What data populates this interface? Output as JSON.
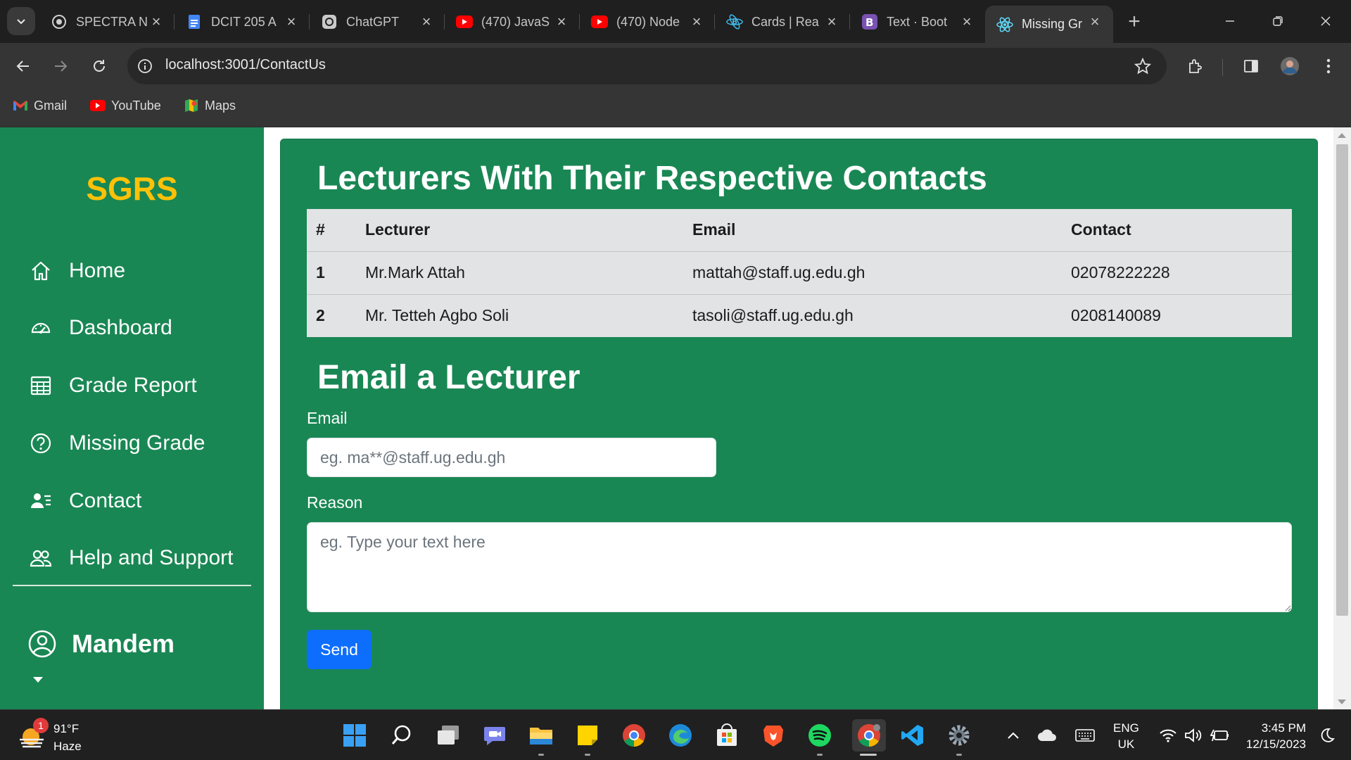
{
  "browser": {
    "tabs": [
      {
        "title": "SPECTRA N",
        "icon": "spectra-icon"
      },
      {
        "title": "DCIT 205 A",
        "icon": "google-docs-icon"
      },
      {
        "title": "ChatGPT",
        "icon": "chatgpt-icon"
      },
      {
        "title": "(470) JavaS",
        "icon": "youtube-icon"
      },
      {
        "title": "(470) Node",
        "icon": "youtube-icon"
      },
      {
        "title": "Cards | Rea",
        "icon": "react-bootstrap-icon"
      },
      {
        "title": "Text · Boot",
        "icon": "bootstrap-icon"
      },
      {
        "title": "Missing Gr",
        "icon": "react-icon"
      }
    ],
    "active_tab_index": 7,
    "url": "localhost:3001/ContactUs",
    "bookmarks": [
      {
        "label": "Gmail",
        "icon": "gmail-icon"
      },
      {
        "label": "YouTube",
        "icon": "youtube-icon"
      },
      {
        "label": "Maps",
        "icon": "maps-icon"
      }
    ]
  },
  "sidebar": {
    "brand": "SGRS",
    "items": [
      {
        "label": "Home",
        "icon": "home-icon"
      },
      {
        "label": "Dashboard",
        "icon": "speedometer-icon"
      },
      {
        "label": "Grade Report",
        "icon": "table-icon"
      },
      {
        "label": "Missing Grade",
        "icon": "question-circle-icon"
      },
      {
        "label": "Contact",
        "icon": "person-lines-icon"
      },
      {
        "label": "Help and Support",
        "icon": "people-icon"
      }
    ],
    "user": {
      "name": "Mandem",
      "icon": "person-circle-icon"
    }
  },
  "main": {
    "title": "Lecturers With Their Respective Contacts",
    "table": {
      "headers": [
        "#",
        "Lecturer",
        "Email",
        "Contact"
      ],
      "rows": [
        [
          "1",
          "Mr.Mark Attah",
          "mattah@staff.ug.edu.gh",
          "02078222228"
        ],
        [
          "2",
          "Mr. Tetteh Agbo Soli",
          "tasoli@staff.ug.edu.gh",
          "0208140089"
        ]
      ]
    },
    "form": {
      "title": "Email a Lecturer",
      "email_label": "Email",
      "email_value": "",
      "email_placeholder": "eg. ma**@staff.ug.edu.gh",
      "reason_label": "Reason",
      "reason_value": "",
      "reason_placeholder": "eg. Type your text here",
      "send_label": "Send"
    }
  },
  "taskbar": {
    "weather": {
      "temp": "91°F",
      "condition": "Haze",
      "badge": "1"
    },
    "apps": [
      "windows-start-icon",
      "search-icon",
      "task-view-icon",
      "teams-chat-icon",
      "file-explorer-icon",
      "sticky-notes-icon",
      "chrome-icon",
      "edge-icon",
      "microsoft-store-icon",
      "brave-icon",
      "spotify-icon",
      "chrome-profile-icon",
      "vscode-icon",
      "settings-icon"
    ],
    "language": {
      "line1": "ENG",
      "line2": "UK"
    },
    "time": "3:45 PM",
    "date": "12/15/2023"
  },
  "colors": {
    "sidebar_bg": "#198754",
    "brand": "#ffc107",
    "primary_button": "#0d6efd",
    "table_bg": "#e2e3e5"
  }
}
